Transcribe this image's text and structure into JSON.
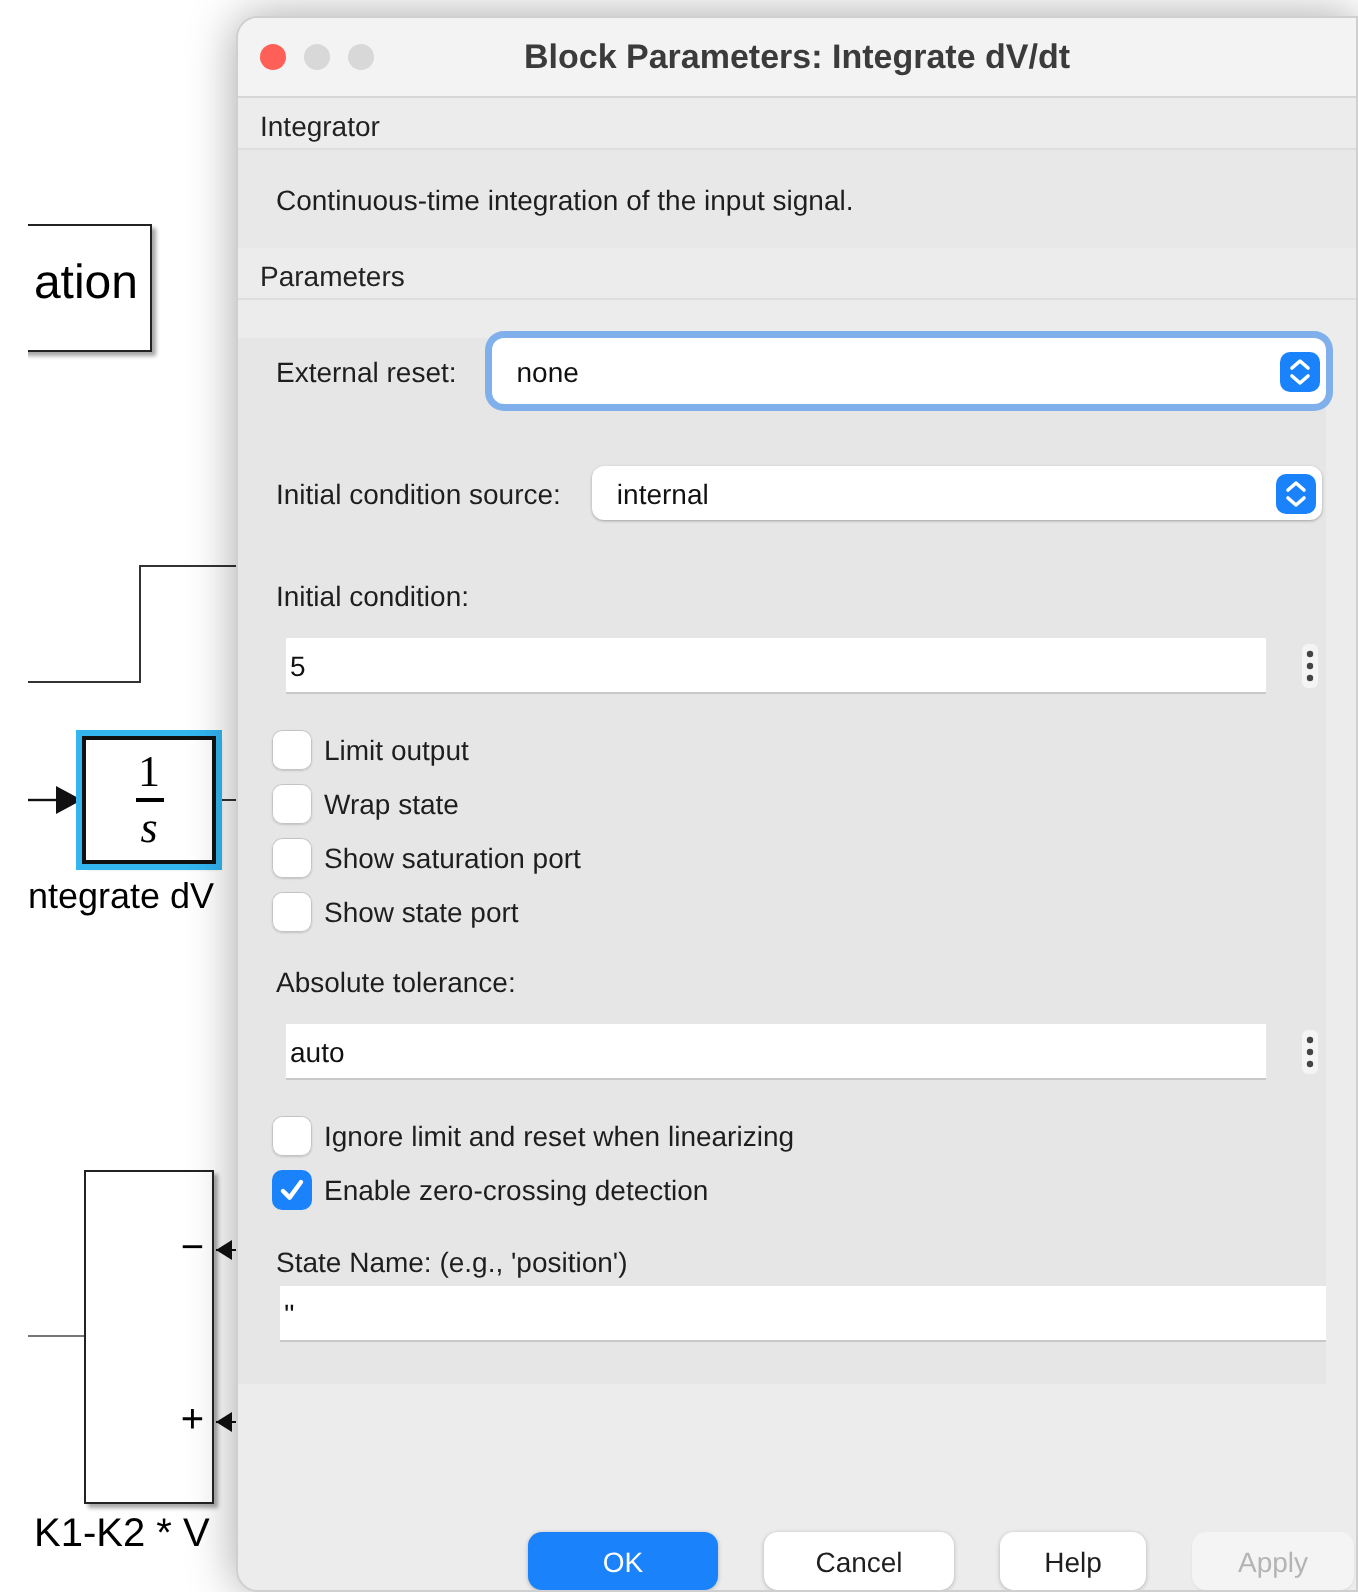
{
  "diagram": {
    "blocks": [
      {
        "kind": "block",
        "label": "ation",
        "selected": false
      },
      {
        "kind": "integrator",
        "numerator": "1",
        "denominator": "s",
        "label": "ntegrate dV",
        "selected": true
      },
      {
        "kind": "sum",
        "ports": [
          "−",
          "+"
        ],
        "label": "K1-K2 * V",
        "selected": false
      }
    ]
  },
  "dialog": {
    "title": "Block Parameters: Integrate dV/dt",
    "block_type": "Integrator",
    "description": "Continuous-time integration of the input signal.",
    "section": "Parameters",
    "rows": [
      {
        "kind": "select",
        "label": "External reset:",
        "value": "none",
        "focused": true
      },
      {
        "kind": "select",
        "label": "Initial condition source:",
        "value": "internal",
        "focused": false
      },
      {
        "kind": "text",
        "label": "Initial condition:",
        "value": "5",
        "more_button": true
      },
      {
        "kind": "checkbox",
        "label": "Limit output",
        "checked": false
      },
      {
        "kind": "checkbox",
        "label": "Wrap state",
        "checked": false
      },
      {
        "kind": "checkbox",
        "label": "Show saturation port",
        "checked": false
      },
      {
        "kind": "checkbox",
        "label": "Show state port",
        "checked": false
      },
      {
        "kind": "text",
        "label": "Absolute tolerance:",
        "value": "auto",
        "more_button": true
      },
      {
        "kind": "checkbox",
        "label": "Ignore limit and reset when linearizing",
        "checked": false
      },
      {
        "kind": "checkbox",
        "label": "Enable zero-crossing detection",
        "checked": true
      },
      {
        "kind": "text",
        "label": "State Name: (e.g., 'position')",
        "value": "''",
        "more_button": false
      }
    ],
    "buttons": [
      {
        "label": "OK",
        "kind": "default",
        "disabled": false
      },
      {
        "label": "Cancel",
        "kind": "normal",
        "disabled": false
      },
      {
        "label": "Help",
        "kind": "normal",
        "disabled": false
      },
      {
        "label": "Apply",
        "kind": "normal",
        "disabled": true
      }
    ]
  }
}
